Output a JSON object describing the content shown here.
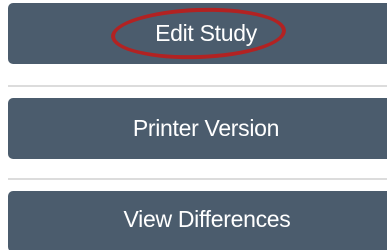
{
  "actions": {
    "edit_study": "Edit Study",
    "printer_version": "Printer Version",
    "view_differences": "View Differences"
  },
  "colors": {
    "button_bg": "#4b5c6d",
    "button_text": "#ffffff",
    "highlight": "#b22222",
    "divider": "#dcdcdc"
  }
}
